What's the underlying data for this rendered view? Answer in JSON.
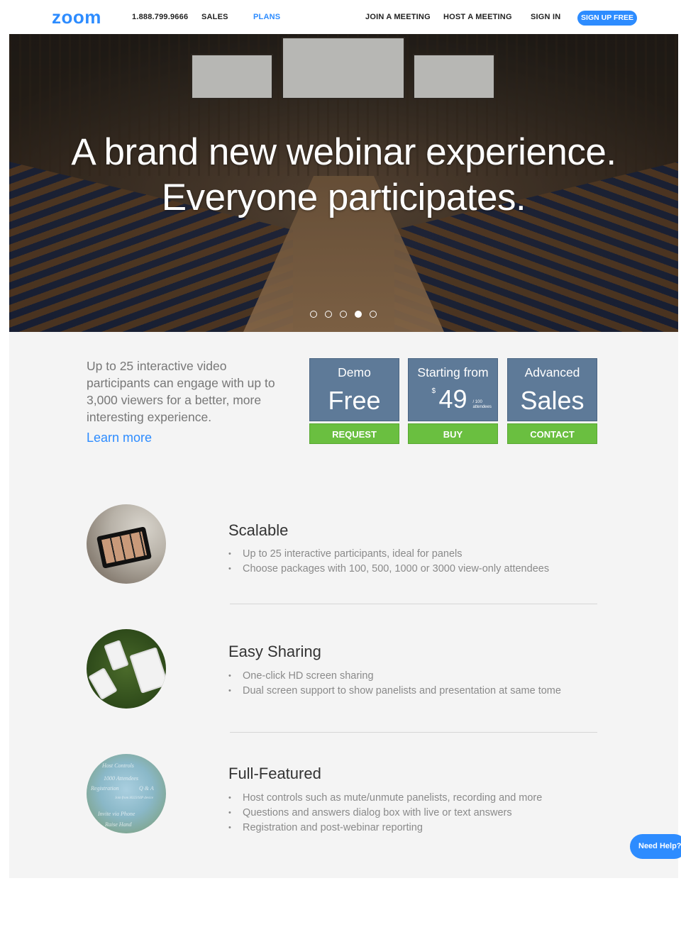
{
  "nav": {
    "logo": "zoom",
    "phone": "1.888.799.9666",
    "sales": "SALES",
    "plans": "PLANS",
    "join": "JOIN A MEETING",
    "host": "HOST A MEETING",
    "signin": "SIGN IN",
    "signup": "SIGN UP FREE"
  },
  "hero": {
    "line1": "A brand new webinar experience.",
    "line2": "Everyone participates.",
    "slides": 5,
    "active_slide": 4
  },
  "pricing": {
    "intro": "Up to 25 interactive video participants can engage with up to 3,000 viewers for a better,  more interesting experience.",
    "learn_more": "Learn more",
    "cards": [
      {
        "name": "Demo",
        "value": "Free",
        "button": "REQUEST"
      },
      {
        "name": "Starting from",
        "currency": "$",
        "price": "49",
        "per_line1": "/ 100",
        "per_line2": "attendees",
        "button": "BUY"
      },
      {
        "name": "Advanced",
        "value": "Sales",
        "button": "CONTACT"
      }
    ]
  },
  "features": [
    {
      "title": "Scalable",
      "items": [
        "Up to 25 interactive participants, ideal for panels",
        "Choose packages with 100, 500, 1000 or 3000 view-only attendees"
      ]
    },
    {
      "title": "Easy Sharing",
      "items": [
        "One-click HD screen sharing",
        "Dual screen support to show panelists and presentation at same tome"
      ]
    },
    {
      "title": "Full-Featured",
      "items": [
        "Host controls such as mute/unmute panelists, recording and more",
        "Questions and answers dialog box with live or text answers",
        "Registration and post-webinar reporting"
      ]
    }
  ],
  "thumb3_words": [
    "Host Controls",
    "1000 Attendees",
    "Registration",
    "Q & A",
    "Join from H323/SIP device",
    "Invite via Phone",
    "Raise Hand"
  ],
  "help": "Need Help?",
  "colors": {
    "brand": "#2d8cff",
    "card": "#5e7a98",
    "button": "#6abf40"
  }
}
